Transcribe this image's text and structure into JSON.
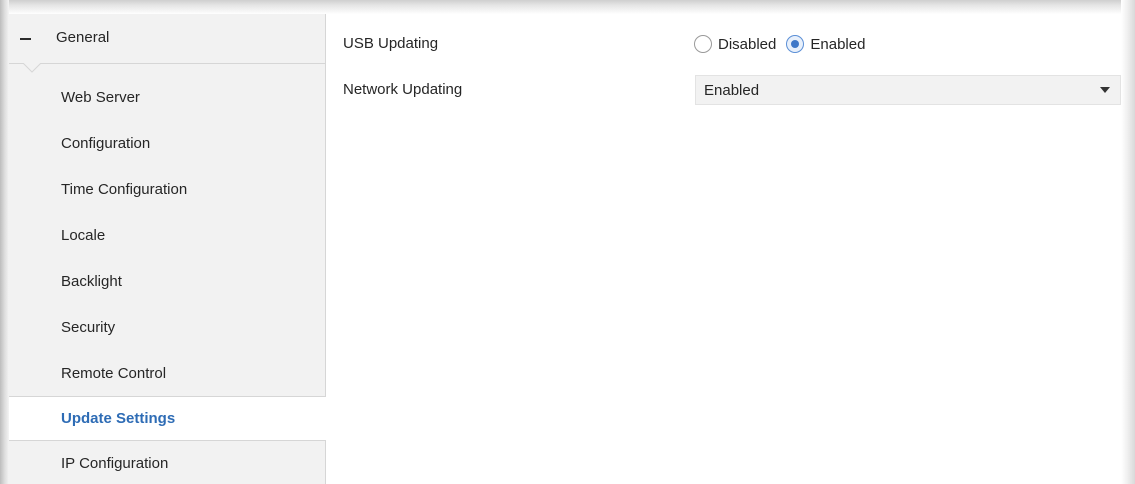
{
  "sidebar": {
    "group": {
      "toggle_icon": "minus-icon",
      "label": "General"
    },
    "items": [
      {
        "label": "Web Server",
        "active": false
      },
      {
        "label": "Configuration",
        "active": false
      },
      {
        "label": "Time Configuration",
        "active": false
      },
      {
        "label": "Locale",
        "active": false
      },
      {
        "label": "Backlight",
        "active": false
      },
      {
        "label": "Security",
        "active": false
      },
      {
        "label": "Remote Control",
        "active": false
      },
      {
        "label": "Update Settings",
        "active": true
      },
      {
        "label": "IP Configuration",
        "active": false
      }
    ]
  },
  "main": {
    "usb_updating": {
      "label": "USB Updating",
      "options": [
        {
          "label": "Disabled",
          "checked": false
        },
        {
          "label": "Enabled",
          "checked": true
        }
      ]
    },
    "network_updating": {
      "label": "Network Updating",
      "selected": "Enabled",
      "arrow_icon": "caret-down-icon"
    }
  },
  "colors": {
    "active_item_text": "#2e6cb5",
    "sidebar_background": "#f2f2f2",
    "radio_selected": "#3f78c8"
  }
}
